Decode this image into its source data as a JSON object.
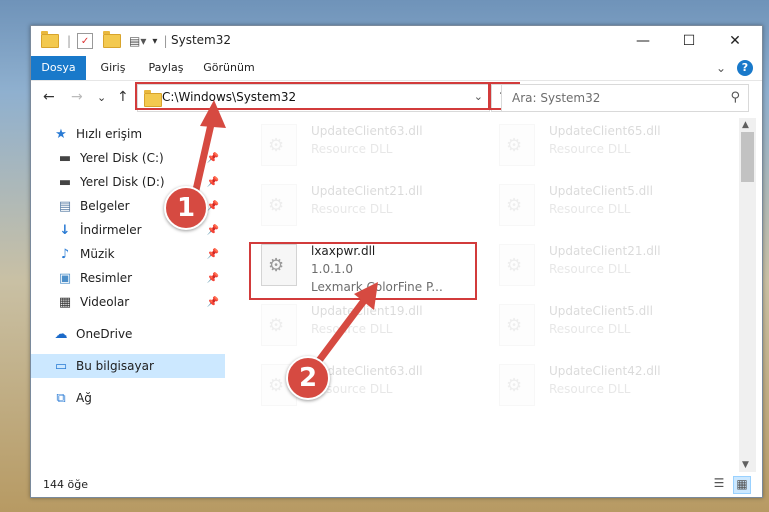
{
  "window": {
    "title": "System32"
  },
  "title_buttons": {
    "minimize": "—",
    "maximize": "☐",
    "close": "✕"
  },
  "ribbon": {
    "tabs": [
      "Dosya",
      "Giriş",
      "Paylaş",
      "Görünüm"
    ],
    "expand": "⌄",
    "help": "?"
  },
  "nav": {
    "back": "←",
    "forward": "→",
    "recent": "⌄",
    "up": "↑",
    "address": "C:\\Windows\\System32",
    "address_dropdown": "⌄",
    "refresh": "↻",
    "search_placeholder": "Ara: System32"
  },
  "sidebar": {
    "items": [
      {
        "label": "Hızlı erişim",
        "icon": "star-icon"
      },
      {
        "label": "Yerel Disk (C:)",
        "icon": "drive-icon",
        "pin": "📌"
      },
      {
        "label": "Yerel Disk (D:)",
        "icon": "drive-icon",
        "pin": "📌"
      },
      {
        "label": "Belgeler",
        "icon": "document-icon",
        "pin": "📌"
      },
      {
        "label": "İndirmeler",
        "icon": "download-icon",
        "pin": "📌"
      },
      {
        "label": "Müzik",
        "icon": "music-icon",
        "pin": "📌"
      },
      {
        "label": "Resimler",
        "icon": "pictures-icon",
        "pin": "📌"
      },
      {
        "label": "Videolar",
        "icon": "video-icon",
        "pin": "📌"
      },
      {
        "label": "OneDrive",
        "icon": "cloud-icon"
      },
      {
        "label": "Bu bilgisayar",
        "icon": "computer-icon",
        "selected": true
      },
      {
        "label": "Ağ",
        "icon": "network-icon"
      }
    ]
  },
  "files": [
    {
      "name": "UpdateClient63.dll",
      "desc": "Resource DLL"
    },
    {
      "name": "UpdateClient65.dll",
      "desc": "Resource DLL"
    },
    {
      "name": "UpdateClient21.dll",
      "desc": "Resource DLL"
    },
    {
      "name": "UpdateClient5.dll",
      "desc": "Resource DLL"
    },
    {
      "name": "lxaxpwr.dll",
      "desc": "1.0.1.0",
      "desc2": "Lexmark ColorFine P...",
      "highlighted": true
    },
    {
      "name": "UpdateClient21.dll",
      "desc": "Resource DLL"
    },
    {
      "name": "UpdateClient19.dll",
      "desc": "Resource DLL"
    },
    {
      "name": "UpdateClient5.dll",
      "desc": "Resource DLL"
    },
    {
      "name": "UpdateClient63.dll",
      "desc": "Resource DLL"
    },
    {
      "name": "UpdateClient42.dll",
      "desc": "Resource DLL"
    }
  ],
  "status": {
    "count": "144 öğe"
  },
  "callouts": [
    "1",
    "2"
  ],
  "colors": {
    "accent": "#1979ca",
    "highlight": "#d23b3b",
    "callout": "#d64a41",
    "selected": "#cce8ff"
  }
}
